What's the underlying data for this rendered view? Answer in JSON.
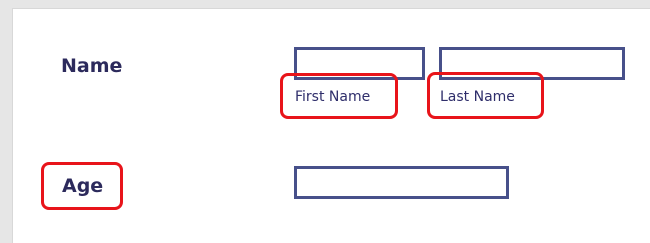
{
  "form": {
    "name_label": "Name",
    "first_name_label": "First Name",
    "last_name_label": "Last Name",
    "age_label": "Age",
    "first_name_value": "",
    "last_name_value": "",
    "age_value": ""
  },
  "colors": {
    "label_text": "#2c2a5c",
    "field_border": "#47508a",
    "highlight": "#e8141a",
    "page_background": "#e6e6e6",
    "panel_background": "#ffffff"
  }
}
